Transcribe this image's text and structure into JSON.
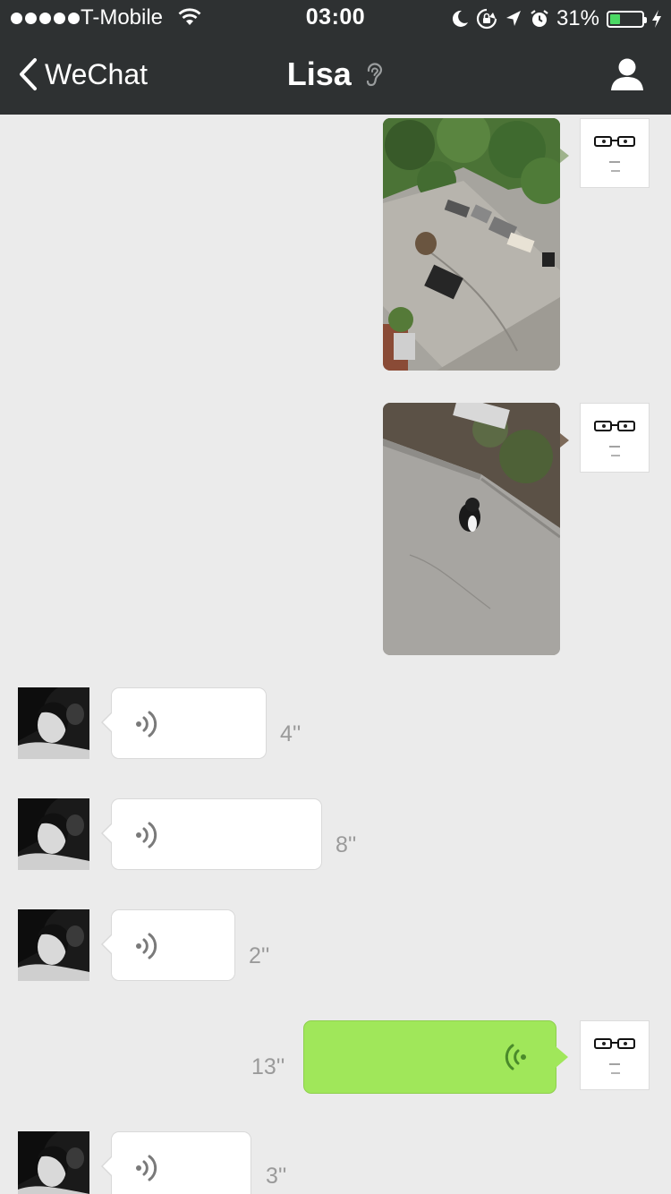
{
  "status_bar": {
    "carrier": "T-Mobile",
    "time": "03:00",
    "battery_percent": "31%",
    "battery_level": 0.31,
    "signal_bars": 5,
    "icons": [
      "wifi-icon",
      "moon-icon",
      "rotation-lock-icon",
      "location-arrow-icon",
      "alarm-icon",
      "battery-icon",
      "charging-bolt-icon"
    ]
  },
  "nav": {
    "back_label": "WeChat",
    "title": "Lisa",
    "icons": [
      "chevron-left-icon",
      "ear-icon",
      "profile-icon"
    ]
  },
  "colors": {
    "header_bg": "#2e3132",
    "chat_bg": "#ebebeb",
    "outgoing_bubble": "#a0e75a",
    "incoming_bubble": "#ffffff",
    "battery_fill": "#4cd964"
  },
  "messages": [
    {
      "sender": "me",
      "type": "photo"
    },
    {
      "sender": "me",
      "type": "photo"
    },
    {
      "sender": "Lisa",
      "type": "voice",
      "duration": "4''"
    },
    {
      "sender": "Lisa",
      "type": "voice",
      "duration": "8''"
    },
    {
      "sender": "Lisa",
      "type": "voice",
      "duration": "2''"
    },
    {
      "sender": "me",
      "type": "voice",
      "duration": "13''"
    },
    {
      "sender": "Lisa",
      "type": "voice",
      "duration": "3''"
    }
  ]
}
